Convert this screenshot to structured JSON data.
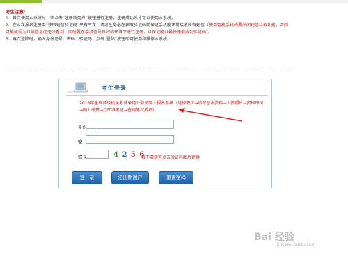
{
  "notice": {
    "title": "考生注意:",
    "line1": "1、首次使用本系统时，须点击“注册新用户”按钮进行注册，注册成功后才可以使用本系统。",
    "line2a": "2、在本次报名注册中“获取短信验证码”只有三次，请考生务必在获取验证码前保证手机能正常接收所有短信（",
    "line2b": "使用智能手机的要关闭短信拦截功能，否则可能被视为垃圾信息而无法看到！同时要在手机信号良好的环境下进行注册，以保证能以最快速度收到验证码",
    "line2c": "）。",
    "line3": "3、再次登陆时，输入身份证号、密码、验证码，点击“登陆”按钮即可使用和操作本系统。"
  },
  "panel": {
    "title": "考生登录",
    "description": "2016年全省各级机关考试录用公务员网上报名系统（选择职位→填写基本资料→上传照片→资格审核→网上缴费→打印准考证→查询笔试成绩）"
  },
  "form": {
    "id_label": "身份证号：",
    "id_value": "",
    "password_label": "密　　码：",
    "password_value": "",
    "captcha_label": "验 证 码：",
    "captcha_value": "",
    "captcha_digits": [
      "4",
      "2",
      "5",
      "6"
    ],
    "captcha_colors": [
      "#3a8a3a",
      "#2e6fb0",
      "#c43030",
      "#c43030"
    ],
    "captcha_hint": "看不清楚可点击验证码图片更换"
  },
  "buttons": {
    "login": "登　录",
    "register": "注册新用户",
    "reset_password": "重置密码"
  },
  "watermark": {
    "brand": "Bai 经验",
    "url": "jingyan.baidu.com"
  }
}
